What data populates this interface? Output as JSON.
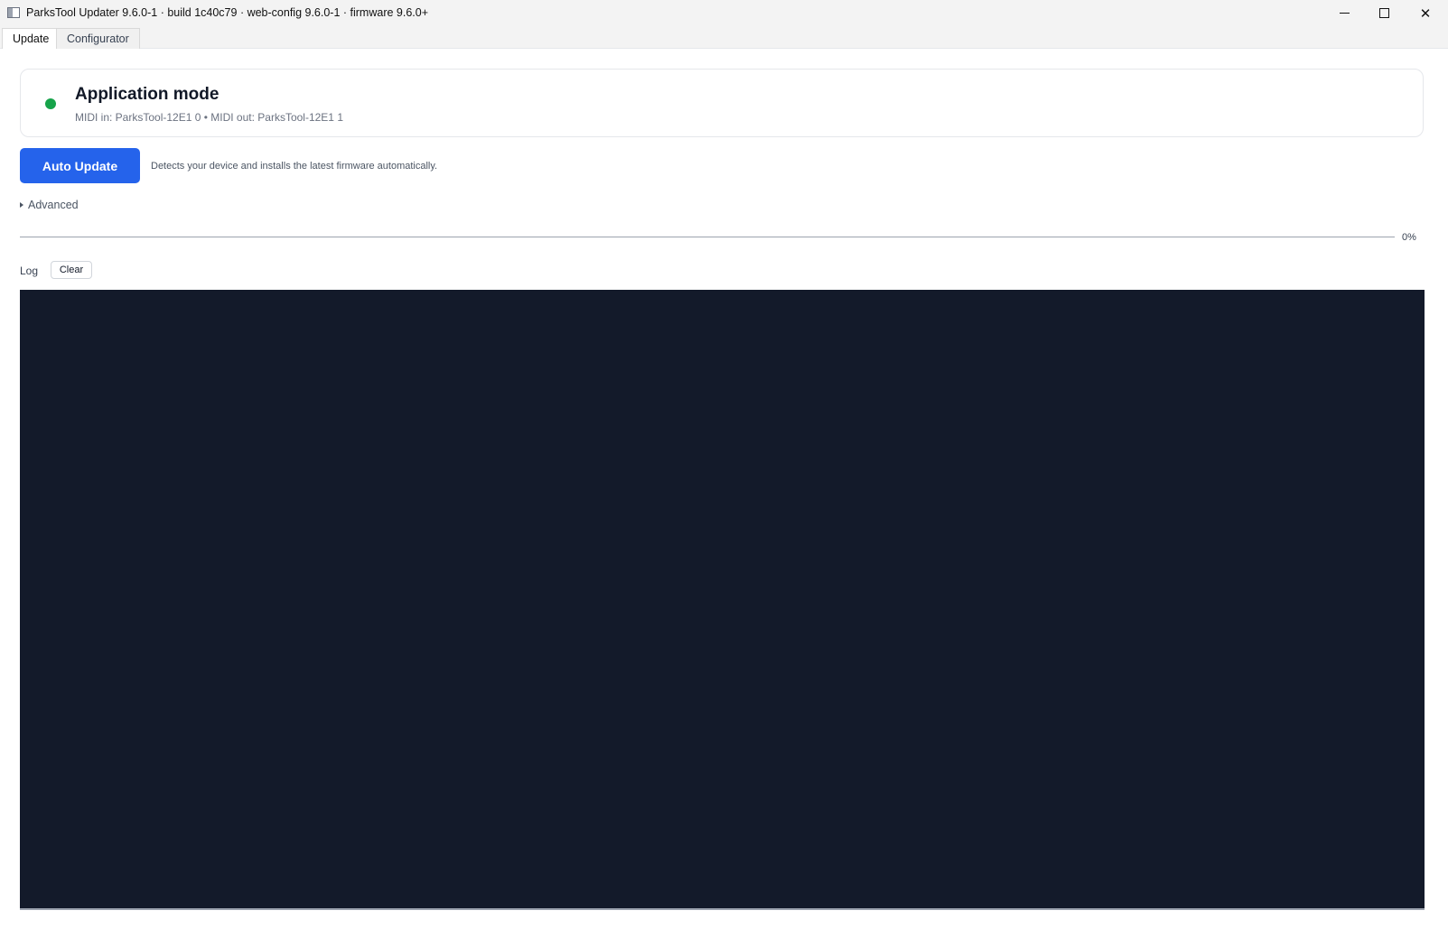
{
  "window": {
    "title": "ParksTool Updater 9.6.0-1  ·  build 1c40c79  ·  web-config 9.6.0-1  ·  firmware 9.6.0+",
    "icon": "app-window-icon",
    "controls": {
      "minimize": "minimize-icon",
      "maximize": "maximize-icon",
      "close": "✕"
    }
  },
  "tabs": [
    {
      "label": "Update",
      "active": true
    },
    {
      "label": "Configurator",
      "active": false
    }
  ],
  "status": {
    "title": "Application mode",
    "subtitle": "MIDI in: ParksTool-12E1 0  •  MIDI out: ParksTool-12E1 1",
    "color": "#16a34a"
  },
  "actions": {
    "auto_update_label": "Auto Update",
    "auto_update_desc": "Detects your device and installs the latest firmware automatically.",
    "advanced_label": "Advanced"
  },
  "progress": {
    "value": 0,
    "label": "0%"
  },
  "log": {
    "label": "Log",
    "clear_label": "Clear"
  },
  "colors": {
    "accent": "#2563eb",
    "log_background": "#131a2a"
  }
}
